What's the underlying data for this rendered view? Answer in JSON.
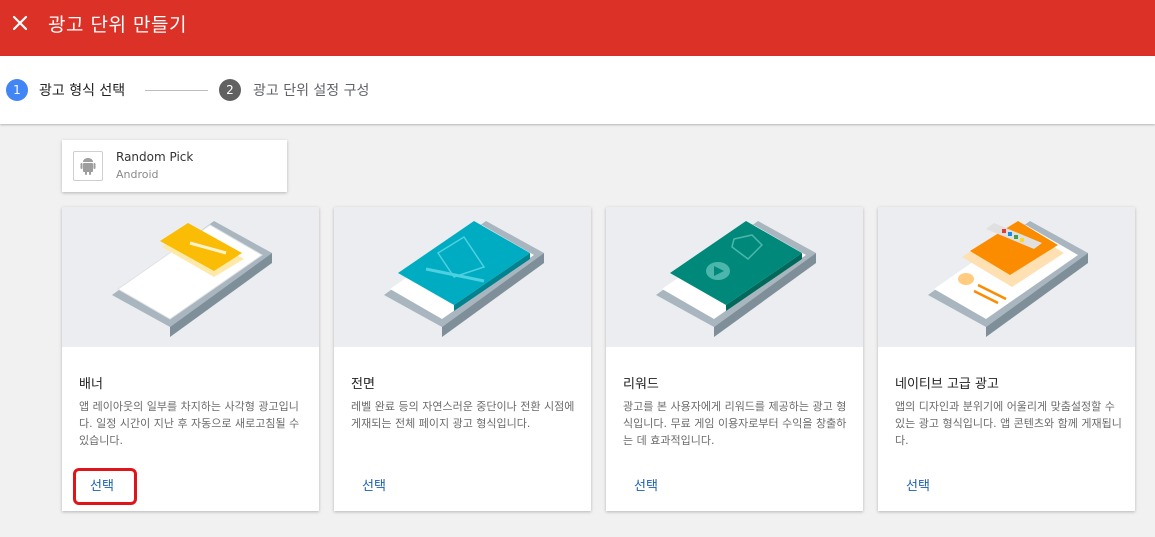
{
  "appbar": {
    "title": "광고 단위 만들기",
    "close_icon": "close-icon"
  },
  "stepper": {
    "steps": [
      {
        "number": "1",
        "label": "광고 형식 선택",
        "active": true
      },
      {
        "number": "2",
        "label": "광고 단위 설정 구성",
        "active": false
      }
    ]
  },
  "app": {
    "name": "Random Pick",
    "platform": "Android",
    "icon": "android-icon"
  },
  "cards": [
    {
      "title": "배너",
      "description": "앱 레이아웃의 일부를 차지하는 사각형 광고입니다. 일정 시간이 지난 후 자동으로 새로고침될 수 있습니다.",
      "button": "선택",
      "highlighted": true
    },
    {
      "title": "전면",
      "description": "레벨 완료 등의 자연스러운 중단이나 전환 시점에 게재되는 전체 페이지 광고 형식입니다.",
      "button": "선택"
    },
    {
      "title": "리워드",
      "description": "광고를 본 사용자에게 리워드를 제공하는 광고 형식입니다. 무료 게임 이용자로부터 수익을 창출하는 데 효과적입니다.",
      "button": "선택"
    },
    {
      "title": "네이티브 고급 광고",
      "description": "앱의 디자인과 분위기에 어울리게 맞춤설정할 수 있는 광고 형식입니다. 앱 콘텐츠와 함께 게재됩니다.",
      "button": "선택"
    }
  ],
  "colors": {
    "appbar": "#db3127",
    "step_active": "#4285f4",
    "link": "#1a5fb4",
    "highlight": "#e0151b"
  }
}
